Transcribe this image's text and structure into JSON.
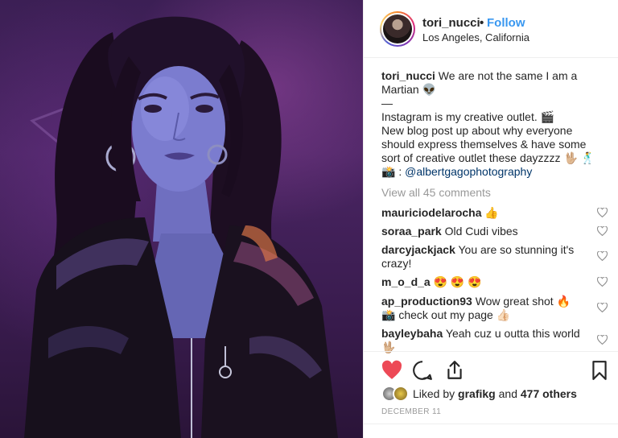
{
  "post": {
    "username": "tori_nucci",
    "separator": "•",
    "follow_label": "Follow",
    "location": "Los Angeles, California",
    "caption": {
      "user": "tori_nucci",
      "line1": "We are not the same I am a",
      "line2": "Martian 👽",
      "line3": "—",
      "line4": "Instagram is my creative outlet. 🎬",
      "line5": "New blog post up about why everyone",
      "line6": "should express themselves & have some",
      "line7": "sort of creative outlet these dayzzzz 🖖🏼 🕺",
      "line8_prefix": "📸 : ",
      "line8_mention": "@albertgagophotography"
    },
    "view_all_comments": "View all 45 comments",
    "comments": [
      {
        "user": "mauriciodelarocha",
        "text": "👍"
      },
      {
        "user": "soraa_park",
        "text": "Old Cudi vibes"
      },
      {
        "user": "darcyjackjack",
        "text": "You are so stunning it's",
        "text2": "crazy!"
      },
      {
        "user": "m_o_d_a",
        "text": "😍 😍 😍"
      },
      {
        "user": "ap_production93",
        "text": "Wow great shot 🔥",
        "text2": "📸 check out my page 👍🏻"
      },
      {
        "user": "bayleybaha",
        "text": "Yeah cuz u outta this world",
        "text2": "🖖🏼"
      }
    ],
    "likes": {
      "prefix": "Liked by",
      "user": "grafikg",
      "middle": "and",
      "others": "477 others"
    },
    "date": "DECEMBER 11",
    "icons": [
      "heart-filled-icon",
      "comment-icon",
      "share-icon",
      "bookmark-icon",
      "heart-outline-icon"
    ],
    "colors": {
      "like_red": "#ed4956",
      "follow_blue": "#3897f0",
      "muted": "#999999",
      "text": "#262626"
    }
  }
}
